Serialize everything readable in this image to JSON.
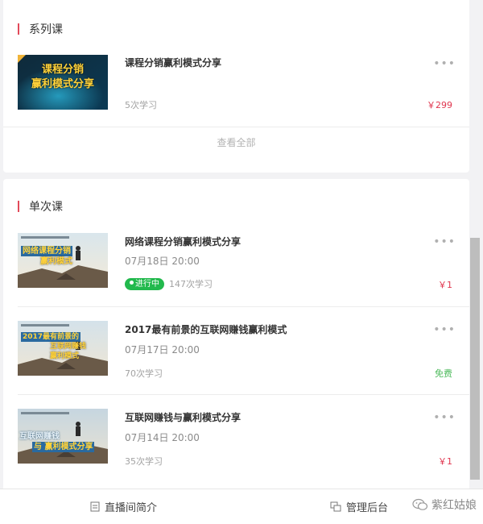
{
  "series_section": {
    "title": "系列课",
    "course": {
      "thumb_lines": [
        "课程分销",
        "赢利模式分享"
      ],
      "title": "课程分销赢利模式分享",
      "learners": "5次学习",
      "price": "￥299"
    },
    "view_all": "查看全部"
  },
  "single_section": {
    "title": "单次课",
    "courses": [
      {
        "title": "网络课程分销赢利模式分享",
        "date": "07月18日 20:00",
        "badge": "进行中",
        "learners": "147次学习",
        "price": "￥1",
        "thumb_lines": [
          "网络课程分销",
          "赢利模式"
        ]
      },
      {
        "title": "2017最有前景的互联网赚钱赢利模式",
        "date": "07月17日 20:00",
        "learners": "70次学习",
        "price": "免费",
        "thumb_lines": [
          "2017最有前景的",
          "互联网赚钱",
          "赢利模式"
        ]
      },
      {
        "title": "互联网赚钱与赢利模式分享",
        "date": "07月14日 20:00",
        "learners": "35次学习",
        "price": "￥1",
        "thumb_lines": [
          "互联网赚钱",
          "与 赢利模式分享"
        ]
      }
    ]
  },
  "bottom_bar": {
    "intro": "直播间简介",
    "admin": "管理后台"
  },
  "watermark": "紫红姑娘",
  "colors": {
    "accent": "#e24a5a",
    "price": "#e0364f",
    "free": "#4cba5b",
    "live": "#22b94d"
  }
}
